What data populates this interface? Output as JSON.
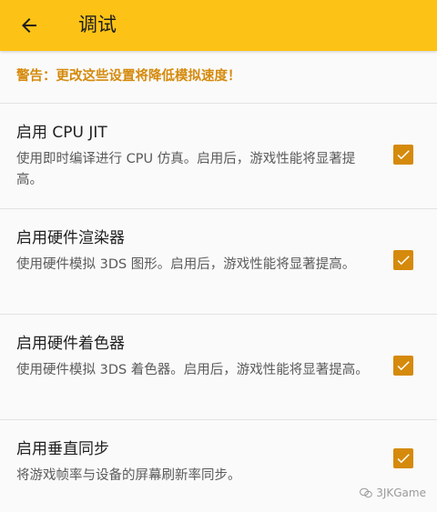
{
  "appbar": {
    "title": "调试",
    "back_icon": "arrow-left-icon"
  },
  "warning": "警告：更改这些设置将降低模拟速度！",
  "settings": [
    {
      "title": "启用 CPU JIT",
      "description": "使用即时编译进行 CPU 仿真。启用后，游戏性能将显著提高。",
      "checked": true
    },
    {
      "title": "启用硬件渲染器",
      "description": "使用硬件模拟 3DS 图形。启用后，游戏性能将显著提高。",
      "checked": true
    },
    {
      "title": "启用硬件着色器",
      "description": "使用硬件模拟 3DS 着色器。启用后，游戏性能将显著提高。",
      "checked": true
    },
    {
      "title": "启用垂直同步",
      "description": "将游戏帧率与设备的屏幕刷新率同步。",
      "checked": true
    }
  ],
  "watermark": "3JKGame",
  "colors": {
    "appbar": "#fcc316",
    "accent": "#d58a0c"
  }
}
